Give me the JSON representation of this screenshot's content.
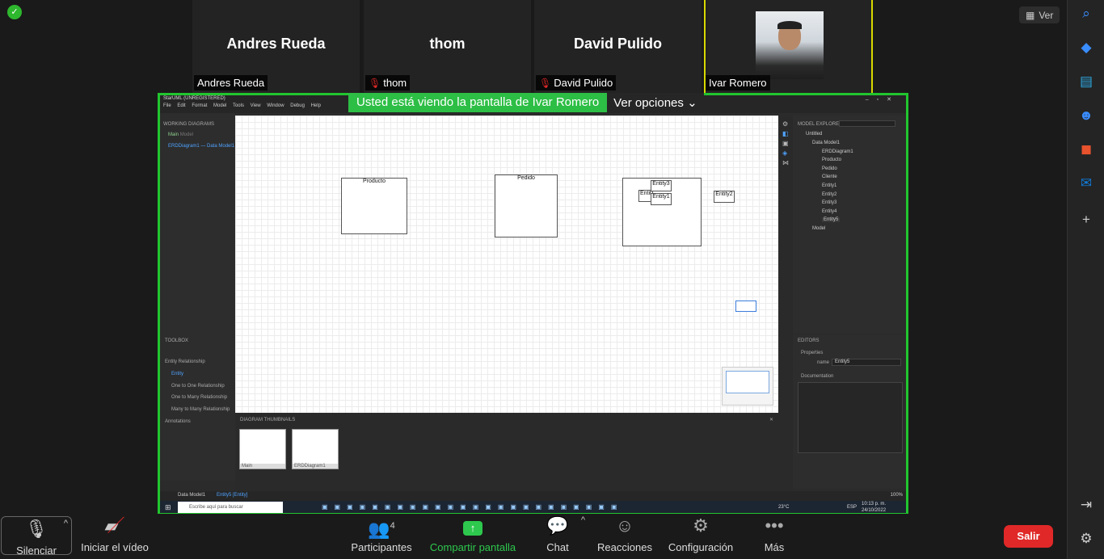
{
  "top": {
    "view_label": "Ver"
  },
  "participants": [
    {
      "big": "Andres Rueda",
      "name": "Andres Rueda",
      "muted": false
    },
    {
      "big": "thom",
      "name": "thom",
      "muted": true
    },
    {
      "big": "David Pulido",
      "name": "David Pulido",
      "muted": true
    },
    {
      "big": "",
      "name": "Ivar Romero",
      "muted": false
    }
  ],
  "banner": {
    "text": "Usted está viendo la pantalla de Ivar Romero",
    "options": "Ver opciones"
  },
  "app": {
    "title": "StarUML (UNREGISTERED)",
    "menu": [
      "File",
      "Edit",
      "Format",
      "Model",
      "Tools",
      "View",
      "Window",
      "Debug",
      "Help"
    ],
    "working_diagrams": "WORKING DIAGRAMS",
    "wd_items": [
      "Main",
      "ERDDiagram1 — Data Model1"
    ],
    "wd_tag": "Model",
    "entities": [
      "Producto",
      "Pedido",
      "Entity3",
      "Entity1",
      "Entity2",
      "Entit"
    ],
    "toolbox": {
      "title": "TOOLBOX",
      "group": "Entity Relationship",
      "items": [
        "Entity",
        "One to One Relationship",
        "One to Many Relationship",
        "Many to Many Relationship"
      ],
      "annotations": "Annotations"
    },
    "thumbs": {
      "title": "DIAGRAM THUMBNAILS",
      "items": [
        "Main",
        "ERDDiagram1"
      ]
    },
    "model_explorer": {
      "title": "MODEL EXPLORER",
      "tree": [
        "Untitled",
        "Data Model1",
        "ERDDiagram1",
        "Producto",
        "Pedido",
        "Cliente",
        "Entity1",
        "Entity2",
        "Entity3",
        "Entity4",
        "Entity5",
        "Model"
      ]
    },
    "editors": {
      "title": "EDITORS",
      "properties": "Properties",
      "name_label": "name",
      "name_value": "Entity5",
      "documentation": "Documentation"
    },
    "status": {
      "left": "Data Model1",
      "sel": "Entity5 [Entity]",
      "zoom": "100%"
    },
    "taskbar": {
      "search": "Escribe aquí para buscar",
      "temp": "23°C",
      "lang": "ESP",
      "time": "10:13 p. m.",
      "date": "24/10/2022"
    }
  },
  "bottom": {
    "mute": "Silenciar",
    "video": "Iniciar el vídeo",
    "participants": "Participantes",
    "participants_count": "4",
    "share": "Compartir pantalla",
    "chat": "Chat",
    "reactions": "Reacciones",
    "settings": "Configuración",
    "more": "Más",
    "leave": "Salir"
  }
}
